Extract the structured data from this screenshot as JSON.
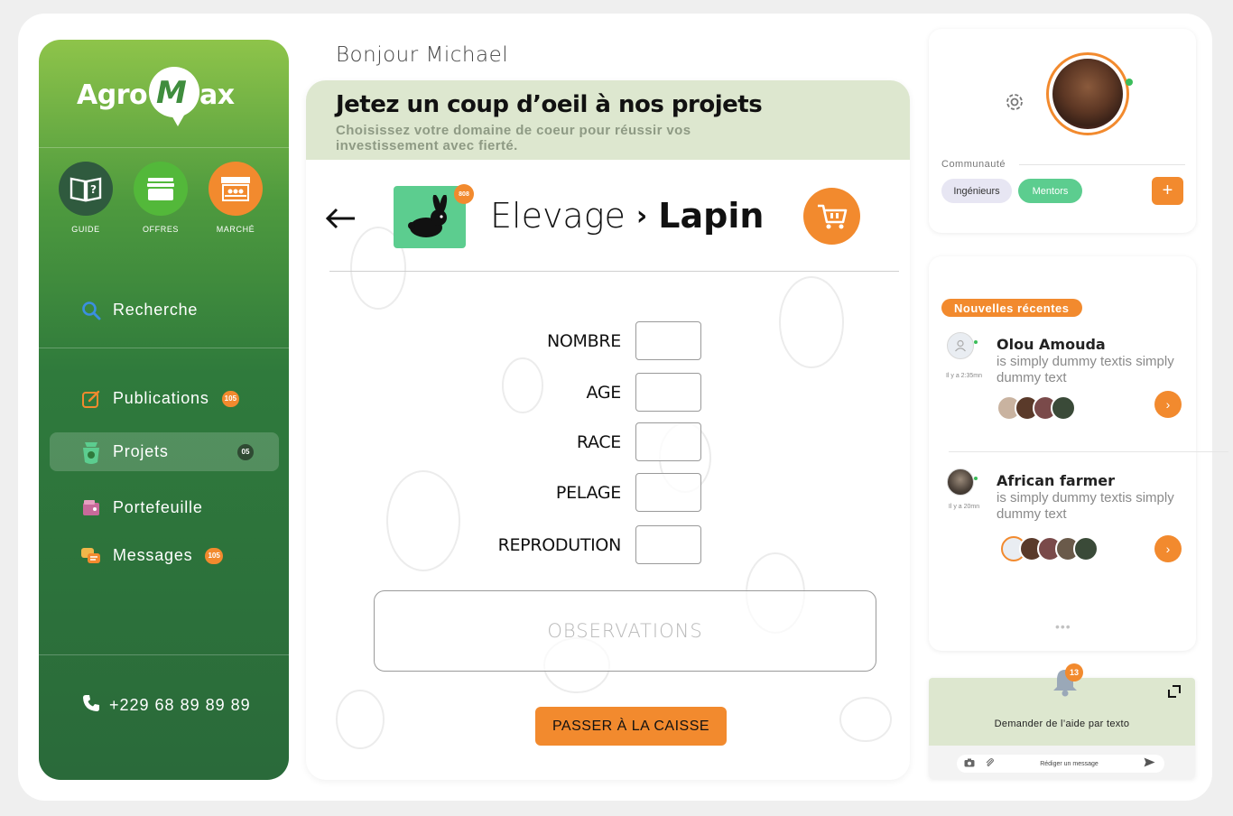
{
  "brand": {
    "name_left": "Agro",
    "name_mark": "M",
    "name_right": "ax"
  },
  "quick_links": [
    {
      "label": "GUIDE",
      "icon": "guide-book-icon",
      "color": "#2f5a3e"
    },
    {
      "label": "OFFRES",
      "icon": "offers-box-icon",
      "color": "#53b83a"
    },
    {
      "label": "MARCHÉ",
      "icon": "market-stall-icon",
      "color": "#f28a2e"
    }
  ],
  "nav": {
    "search": "Recherche",
    "publications": {
      "label": "Publications",
      "badge": "105"
    },
    "projets": {
      "label": "Projets",
      "badge": "05"
    },
    "portefeuille": {
      "label": "Portefeuille"
    },
    "messages": {
      "label": "Messages",
      "badge": "105"
    }
  },
  "phone": "+229 68 89 89 89",
  "greeting": "Bonjour Michael",
  "header": {
    "title": "Jetez un coup d’oeil à nos projets",
    "subtitle": "Choisissez votre domaine  de coeur pour réussir vos investissement avec fierté."
  },
  "project": {
    "category": "Elevage",
    "current": "Lapin",
    "count_badge": "808"
  },
  "form": {
    "fields": [
      "NOMBRE",
      "AGE",
      "RACE",
      "PELAGE",
      "REPRODUTION"
    ],
    "observations_placeholder": "OBSERVATIONS",
    "submit_label": "PASSER À LA CAISSE"
  },
  "profile": {
    "community_label": "Communauté",
    "tags": [
      "Ingénieurs",
      "Mentors"
    ],
    "add_label": "+"
  },
  "news": {
    "tag": "Nouvelles récentes",
    "items": [
      {
        "name": "Olou Amouda",
        "text": "is simply dummy textis simply dummy text",
        "time": "Il y a 2:35mn"
      },
      {
        "name": "African farmer",
        "text": "is simply dummy textis simply dummy text",
        "time": "Il y a 20mn"
      }
    ],
    "more": "•••"
  },
  "help": {
    "notif_count": "13",
    "title": "Demander de l’aide par texto",
    "message_placeholder": "Rédiger un message"
  },
  "colors": {
    "accent": "#f28a2e",
    "green": "#5ccd8f",
    "sidebar": "#2f7a3c"
  }
}
